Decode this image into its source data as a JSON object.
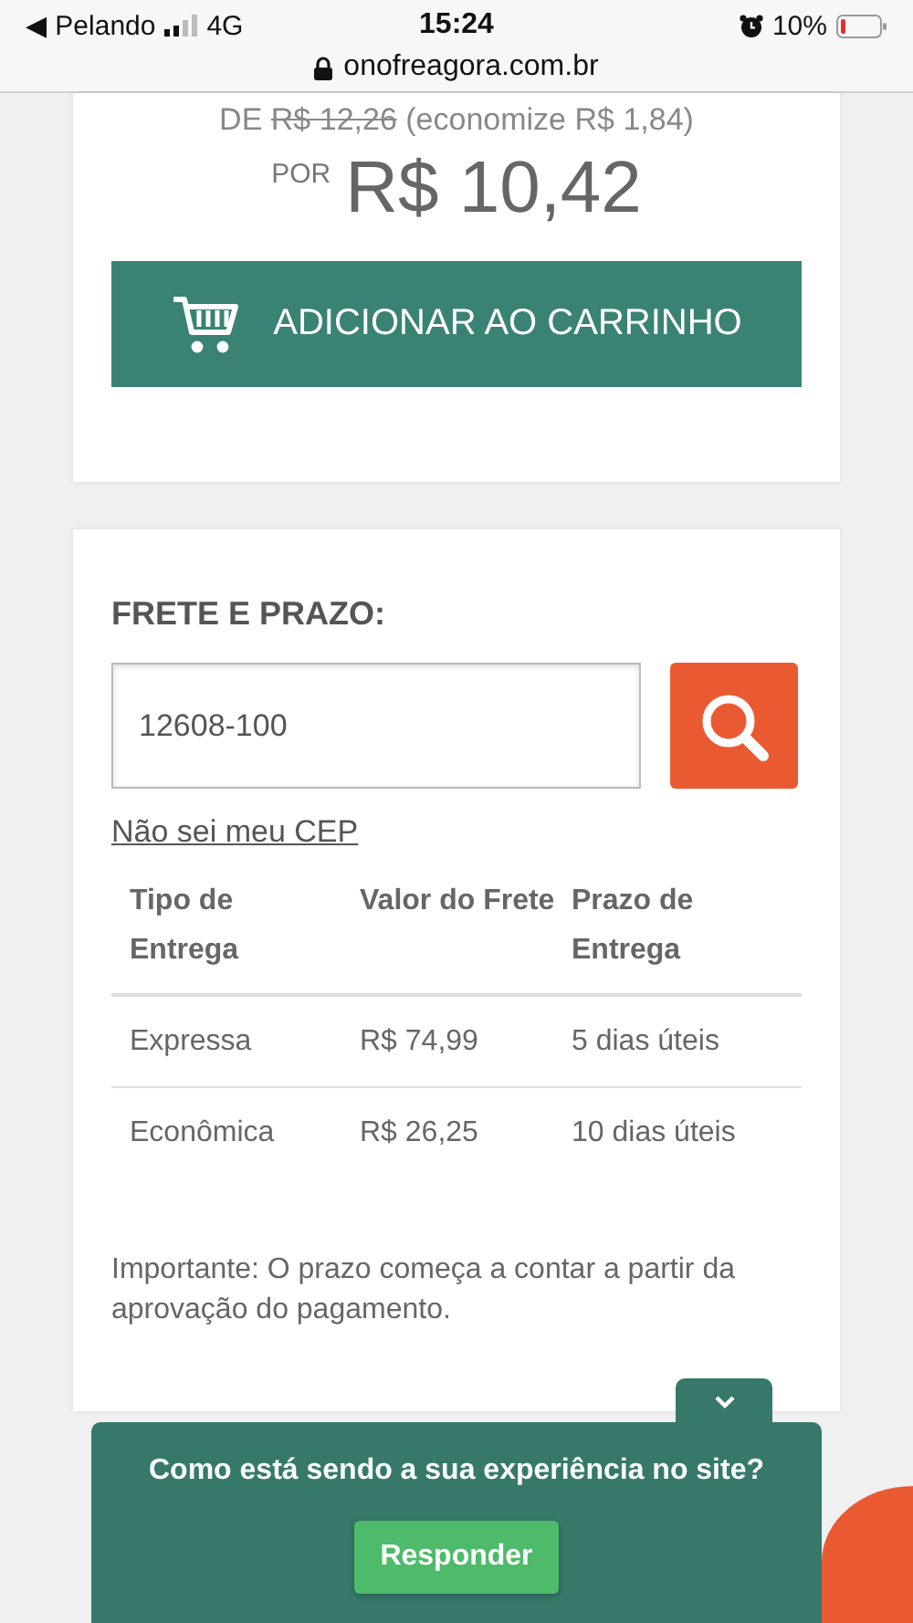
{
  "status_bar": {
    "back_app": "◀ Pelando",
    "network": "4G",
    "time": "15:24",
    "battery": "10%",
    "url": "onofreagora.com.br"
  },
  "price": {
    "prefix": "DE",
    "old_price": "R$ 12,26",
    "savings": "(economize R$ 1,84)",
    "label": "POR",
    "current_price": "R$ 10,42"
  },
  "add_to_cart_button": "ADICIONAR AO CARRINHO",
  "shipping": {
    "title": "FRETE E PRAZO:",
    "cep_value": "12608-100",
    "cep_link": "Não sei meu CEP",
    "columns": [
      "Tipo de Entrega",
      "Valor do Frete",
      "Prazo de Entrega"
    ],
    "rows": [
      {
        "cells": [
          "Expressa",
          "R$ 74,99",
          "5 dias úteis"
        ]
      },
      {
        "cells": [
          "Econômica",
          "R$ 26,25",
          "10 dias úteis"
        ]
      }
    ],
    "note": "Importante: O prazo começa a contar a partir da aprovação do pagamento."
  },
  "feedback": {
    "question": "Como está sendo a sua experiência no site?",
    "button": "Responder"
  }
}
